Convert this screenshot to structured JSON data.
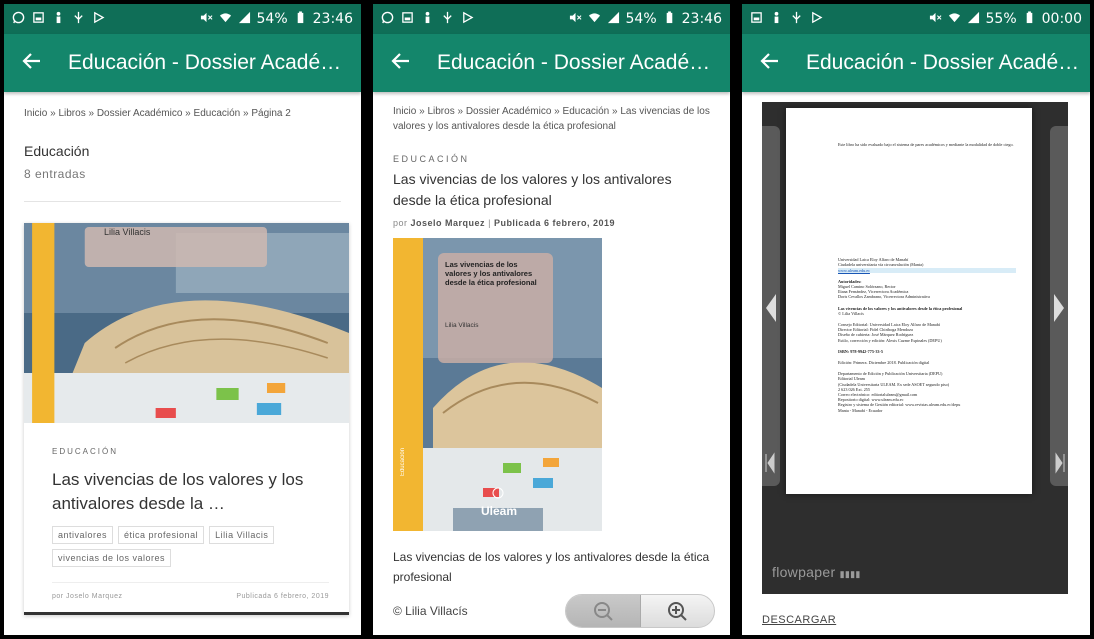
{
  "panel1": {
    "status": {
      "signal": "54%",
      "time": "23:46"
    },
    "appbar_title": "Educación - Dossier Académico",
    "breadcrumb": "Inicio » Libros » Dossier Académico » Educación » Página 2",
    "category_title": "Educación",
    "entries_count": "8 entradas",
    "card": {
      "author_on_cover": "Lilia Villacis",
      "category_label": "EDUCACIÓN",
      "title": "Las vivencias de los valores y los antivalores desde la …",
      "tags": [
        "antivalores",
        "ética profesional",
        "Lilia Villacis",
        "vivencias de los valores"
      ],
      "by": "por Joselo Marquez",
      "published": "Publicada 6 febrero, 2019"
    }
  },
  "panel2": {
    "status": {
      "signal": "54%",
      "time": "23:46"
    },
    "appbar_title": "Educación - Dossier Académico",
    "breadcrumb": "Inicio » Libros » Dossier Académico » Educación » Las vivencias de los valores y los antivalores desde la ética profesional",
    "category_label": "EDUCACIÓN",
    "title": "Las vivencias de los valores y los antivalores desde la ética profesional",
    "meta_prefix": "por",
    "meta_author": "Joselo Marquez",
    "meta_separator": "|",
    "meta_date": "Publicada 6 febrero, 2019",
    "cover": {
      "title": "Las vivencias de los valores y los antivalores desde la ética profesional",
      "author": "Lilia Villacis",
      "publisher": "Uleam",
      "spine": "Educación"
    },
    "description": "Las vivencias de los valores y los antivalores desde la ética profesional",
    "copyright": "© Lilia Villacís"
  },
  "panel3": {
    "status": {
      "signal": "55%",
      "time": "00:00"
    },
    "appbar_title": "Educación - Dossier Académico",
    "page_text": [
      "Este libro ha sido evaluado bajo el sistema de pares académicos y mediante la modalidad de doble ciego.",
      "",
      "Universidad Laica Eloy Alfaro de Manabí",
      "Ciudadela universitaria vía circunvalación (Manta)",
      "www.uleam.edu.ec",
      "",
      "Autoridades:",
      "Miguel Camino Solórzano, Rector",
      "Iliana Fernández, Vicerrectora Académica",
      "Doris Cevallos Zambrano, Vicerrectora Administrativa",
      "",
      "Las vivencias de los valores y los antivalores desde la ética profesional",
      "© Lilia Villacís",
      "",
      "Consejo Editorial: Universidad Laica Eloy Alfaro de Manabí",
      "Director Editorial: Fidel Chiriboga Mendoza",
      "Diseño de cubierta: José Márquez Rodríguez",
      "Estilo, corrección y edición: Alexis Cuzme Espinales (DEPU)",
      "",
      "ISBN: 978-9942-775-33-5",
      "",
      "Edición: Primera. Diciembre 2018. Publicación digital",
      "",
      "Departamento de Edición y Publicación Universitaria (DEPU)",
      "Editorial Uleam",
      "(Ciudadela Universitaria ULEAM. Ex sede ASOET segundo piso)",
      "2 623 026 Ext. 255",
      "Correo electrónico: editorialuleam@gmail.com",
      "Repositorio digital: www.uleam.edu.ec",
      "Registro y sistema de Gestión editorial: www.revistas.uleam.edu.ec/depu",
      "Manta - Manabí - Ecuador"
    ],
    "viewer_brand": "flowpaper",
    "download_label": "DESCARGAR"
  }
}
